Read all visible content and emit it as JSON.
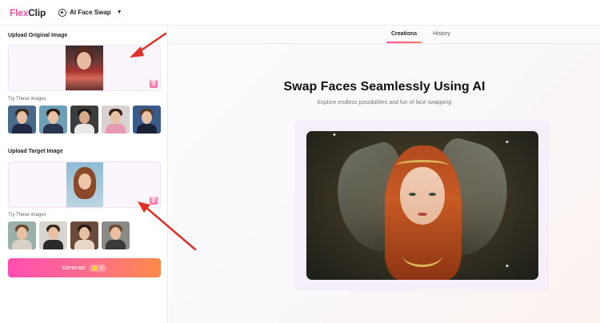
{
  "header": {
    "logo_flex": "Flex",
    "logo_clip": "Clip",
    "tool_name": "AI Face Swap"
  },
  "left_panel": {
    "upload_original_title": "Upload Original Image",
    "upload_target_title": "Upload Target Image",
    "try_label_1": "Try These images",
    "try_label_2": "Try These images",
    "generate_label": "Generate",
    "generate_cost": "-2"
  },
  "tabs": [
    {
      "label": "Creations",
      "active": true
    },
    {
      "label": "History",
      "active": false
    }
  ],
  "main": {
    "title": "Swap Faces Seamlessly Using AI",
    "subtitle": "Explore endless possibilities and fun of face swapping"
  },
  "colors": {
    "accent_pink": "#ff4fa0",
    "accent_orange": "#ff8a4a",
    "arrow_red": "#e0302a"
  },
  "icons": {
    "delete": "trash-icon",
    "credits": "coin-icon",
    "dropdown": "chevron-down-icon"
  }
}
